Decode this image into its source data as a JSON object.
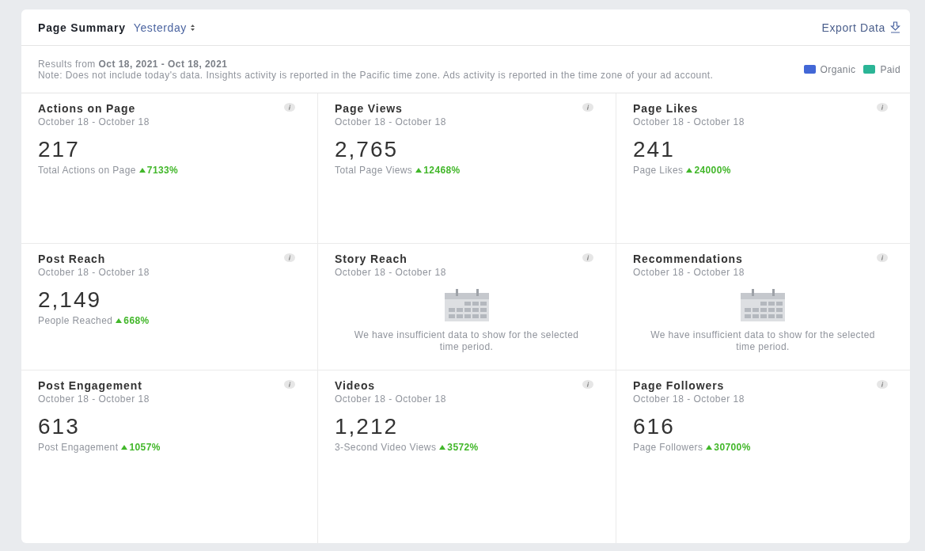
{
  "header": {
    "title": "Page Summary",
    "period": "Yesterday",
    "export": "Export Data"
  },
  "note": {
    "results": "Results from **Oct 18, 2021 - Oct 18, 2021**",
    "text": "Note: Does not include today's data. Insights activity is reported in the Pacific time zone. Ads activity is reported in the time zone of your ad account."
  },
  "legend": [
    {
      "label": "Organic",
      "color": "#4267d6"
    },
    {
      "label": "Paid",
      "color": "#2bb596"
    }
  ],
  "cards": [
    {
      "kind": "metric",
      "title": "Actions on Page",
      "range": "October 18 - October 18",
      "value": "217",
      "caption": "Total Actions on Page",
      "change": "7133%"
    },
    {
      "kind": "metric",
      "title": "Page Views",
      "range": "October 18 - October 18",
      "value": "2,765",
      "caption": "Total Page Views",
      "change": "12468%"
    },
    {
      "kind": "metric",
      "title": "Page Likes",
      "range": "October 18 - October 18",
      "value": "241",
      "caption": "Page Likes",
      "change": "24000%"
    },
    {
      "kind": "metric",
      "title": "Post Reach",
      "range": "October 18 - October 18",
      "value": "2,149",
      "caption": "People Reached",
      "change": "668%"
    },
    {
      "kind": "empty",
      "title": "Story Reach",
      "range": "October 18 - October 18",
      "message": "We have insufficient data to show for the selected time period."
    },
    {
      "kind": "empty",
      "title": "Recommendations",
      "range": "October 18 - October 18",
      "message": "We have insufficient data to show for the selected time period."
    },
    {
      "kind": "metric",
      "title": "Post Engagement",
      "range": "October 18 - October 18",
      "value": "613",
      "caption": "Post Engagement",
      "change": "1057%"
    },
    {
      "kind": "metric",
      "title": "Videos",
      "range": "October 18 - October 18",
      "value": "1,212",
      "caption": "3-Second Video Views",
      "change": "3572%"
    },
    {
      "kind": "metric",
      "title": "Page Followers",
      "range": "October 18 - October 18",
      "value": "616",
      "caption": "Page Followers",
      "change": "30700%"
    }
  ]
}
